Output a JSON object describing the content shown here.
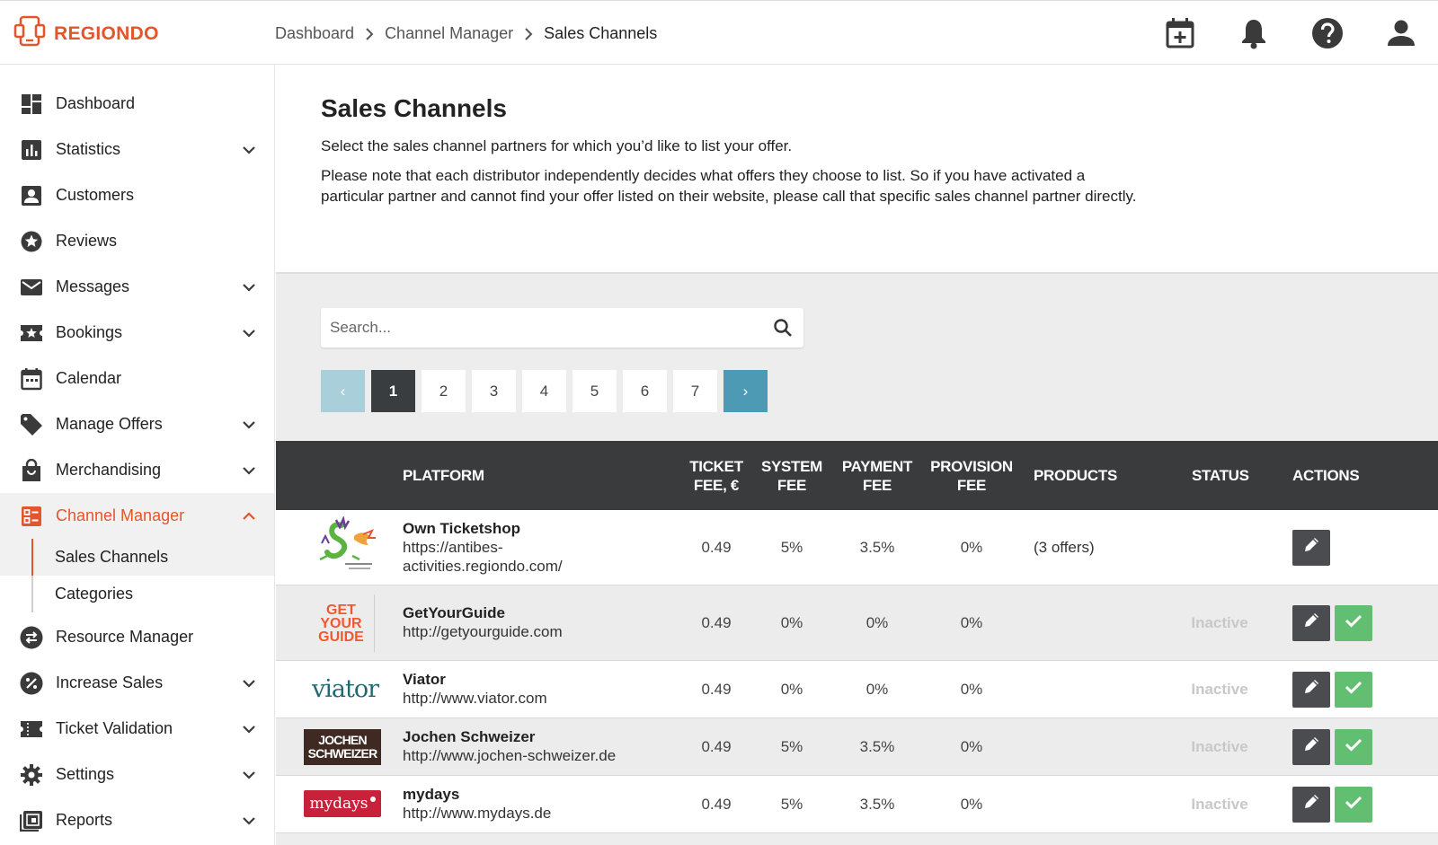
{
  "brand": {
    "name": "REGIONDO",
    "color": "#e2562c"
  },
  "breadcrumb": [
    "Dashboard",
    "Channel Manager",
    "Sales Channels"
  ],
  "top_icons": [
    "calendar-add-icon",
    "bell-icon",
    "help-icon",
    "account-icon"
  ],
  "sidebar": {
    "items": [
      {
        "label": "Dashboard",
        "icon": "dashboard-icon",
        "expandable": false
      },
      {
        "label": "Statistics",
        "icon": "bar-chart-icon",
        "expandable": true
      },
      {
        "label": "Customers",
        "icon": "contact-icon",
        "expandable": false
      },
      {
        "label": "Reviews",
        "icon": "star-icon",
        "expandable": false
      },
      {
        "label": "Messages",
        "icon": "mail-icon",
        "expandable": true
      },
      {
        "label": "Bookings",
        "icon": "ticket-star-icon",
        "expandable": true
      },
      {
        "label": "Calendar",
        "icon": "calendar-icon",
        "expandable": false
      },
      {
        "label": "Manage Offers",
        "icon": "tag-icon",
        "expandable": true
      },
      {
        "label": "Merchandising",
        "icon": "shopping-bag-icon",
        "expandable": true
      },
      {
        "label": "Channel Manager",
        "icon": "channel-icon",
        "expandable": true,
        "active": true
      },
      {
        "label": "Resource Manager",
        "icon": "swap-icon",
        "expandable": false
      },
      {
        "label": "Increase Sales",
        "icon": "percent-icon",
        "expandable": true
      },
      {
        "label": "Ticket Validation",
        "icon": "ticket-icon",
        "expandable": true
      },
      {
        "label": "Settings",
        "icon": "gear-icon",
        "expandable": true
      },
      {
        "label": "Reports",
        "icon": "report-icon",
        "expandable": true
      }
    ],
    "channel_sub": [
      "Sales Channels",
      "Categories"
    ]
  },
  "page": {
    "title": "Sales Channels",
    "intro1": "Select the sales channel partners for which you’d like to list your offer.",
    "intro2": "Please note that each distributor independently decides what offers they choose to list. So if you have activated a particular partner and cannot find your offer listed on their website, please call that specific sales channel partner directly."
  },
  "search": {
    "placeholder": "Search..."
  },
  "pagination": {
    "pages": [
      "1",
      "2",
      "3",
      "4",
      "5",
      "6",
      "7"
    ],
    "current": "1",
    "prev": "‹",
    "next": "›"
  },
  "table": {
    "headers": {
      "platform": "PLATFORM",
      "ticket_fee_1": "TICKET",
      "ticket_fee_2": "FEE, €",
      "system_fee_1": "SYSTEM",
      "system_fee_2": "FEE",
      "payment_fee_1": "PAYMENT",
      "payment_fee_2": "FEE",
      "provision_fee_1": "PROVISION",
      "provision_fee_2": "FEE",
      "products": "PRODUCTS",
      "status": "STATUS",
      "actions": "ACTIONS"
    },
    "rows": [
      {
        "name": "Own Ticketshop",
        "url": "https://antibes-activities.regiondo.com/",
        "ticket_fee": "0.49",
        "system_fee": "5%",
        "payment_fee": "3.5%",
        "provision_fee": "0%",
        "products": "(3 offers)",
        "status": "",
        "logo": "dragon-logo"
      },
      {
        "name": "GetYourGuide",
        "url": "http://getyourguide.com",
        "ticket_fee": "0.49",
        "system_fee": "0%",
        "payment_fee": "0%",
        "provision_fee": "0%",
        "products": "",
        "status": "Inactive",
        "logo": "getyourguide-logo",
        "logo_lines": [
          "GET",
          "YOUR",
          "GUIDE"
        ]
      },
      {
        "name": "Viator",
        "url": "http://www.viator.com",
        "ticket_fee": "0.49",
        "system_fee": "0%",
        "payment_fee": "0%",
        "provision_fee": "0%",
        "products": "",
        "status": "Inactive",
        "logo": "viator-logo",
        "logo_text": "viator"
      },
      {
        "name": "Jochen Schweizer",
        "url": "http://www.jochen-schweizer.de",
        "ticket_fee": "0.49",
        "system_fee": "5%",
        "payment_fee": "3.5%",
        "provision_fee": "0%",
        "products": "",
        "status": "Inactive",
        "logo": "jochen-schweizer-logo",
        "logo_lines": [
          "JOCHEN",
          "SCHWEIZER"
        ]
      },
      {
        "name": "mydays",
        "url": "http://www.mydays.de",
        "ticket_fee": "0.49",
        "system_fee": "5%",
        "payment_fee": "3.5%",
        "provision_fee": "0%",
        "products": "",
        "status": "Inactive",
        "logo": "mydays-logo",
        "logo_text": "mydays"
      }
    ]
  }
}
